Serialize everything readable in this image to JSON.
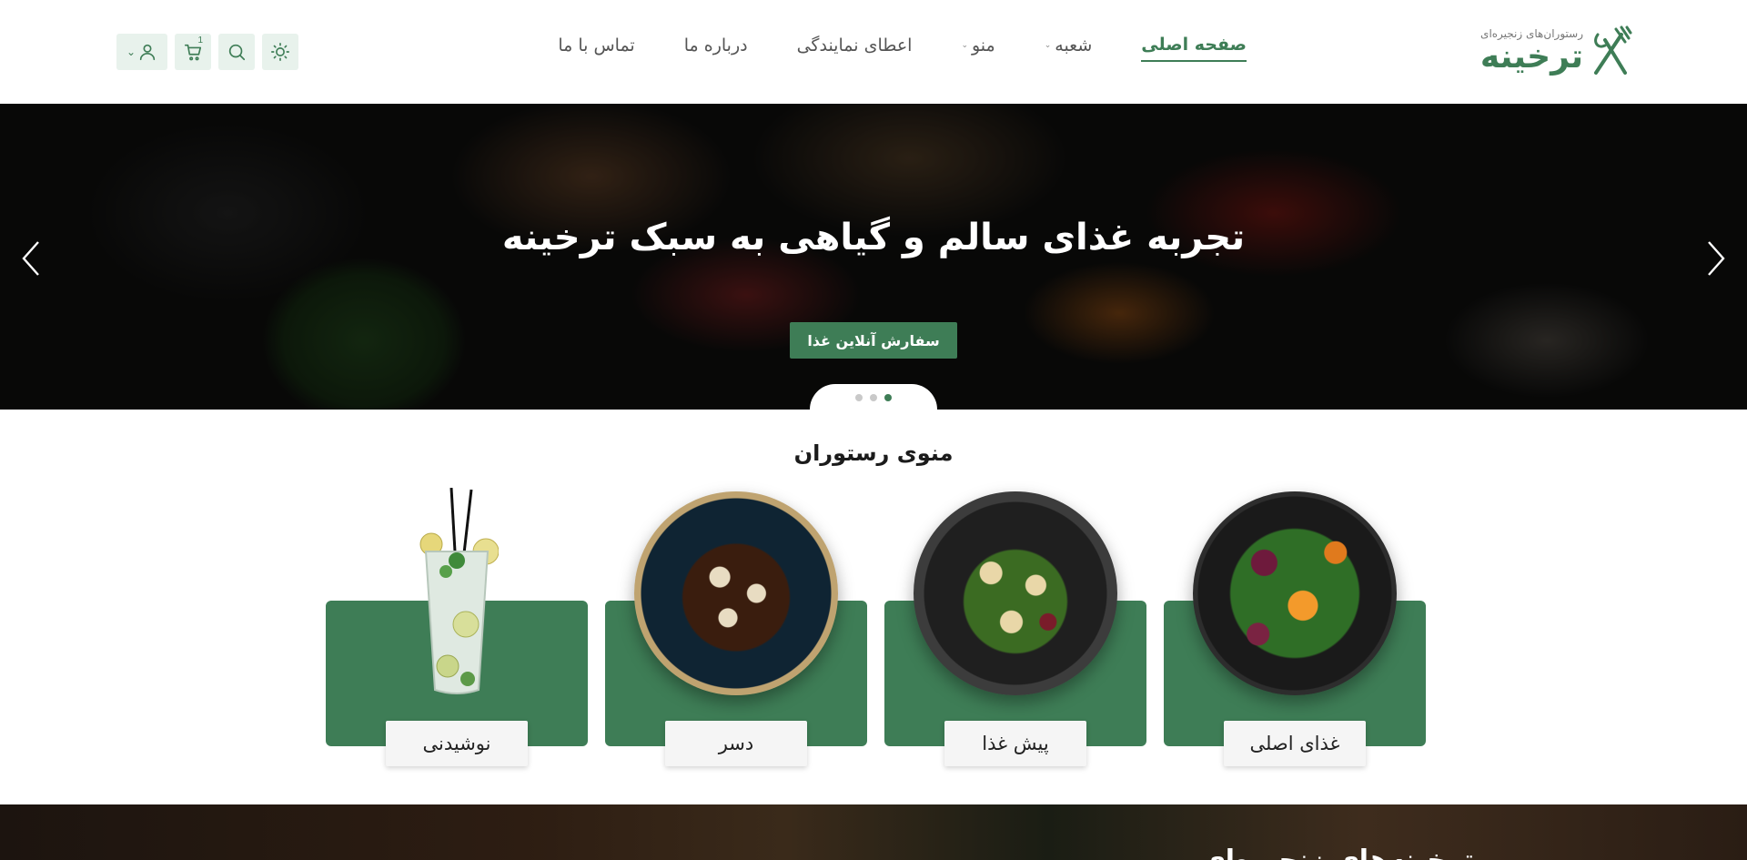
{
  "brand": {
    "name": "ترخینه",
    "subtitle": "رستوران‌های زنجیره‌ای"
  },
  "nav": {
    "items": [
      {
        "label": "صفحه اصلی",
        "active": true,
        "has_dropdown": false
      },
      {
        "label": "شعبه",
        "active": false,
        "has_dropdown": true
      },
      {
        "label": "منو",
        "active": false,
        "has_dropdown": true
      },
      {
        "label": "اعطای نمایندگی",
        "active": false,
        "has_dropdown": false
      },
      {
        "label": "درباره ما",
        "active": false,
        "has_dropdown": false
      },
      {
        "label": "تماس با ما",
        "active": false,
        "has_dropdown": false
      }
    ]
  },
  "toolbar": {
    "theme_icon": "sun-icon",
    "search_icon": "search-icon",
    "cart_icon": "cart-icon",
    "cart_count": "1",
    "user_icon": "user-icon"
  },
  "hero": {
    "title": "تجربه غذای سالم و گیاهی به سبک ترخینه",
    "button_label": "سفارش آنلاین غذا",
    "slides_total": 3,
    "active_slide": 1
  },
  "menu": {
    "title": "منوی رستوران",
    "categories": [
      {
        "label": "غذای اصلی",
        "image": "salad-plate"
      },
      {
        "label": "پیش غذا",
        "image": "starter-plate"
      },
      {
        "label": "دسر",
        "image": "dessert-plate"
      },
      {
        "label": "نوشیدنی",
        "image": "mojito-glass"
      }
    ]
  },
  "bottom": {
    "title": "ترخینه‌های زنجیره‌ای"
  },
  "colors": {
    "accent": "#3e7d56",
    "accent_soft": "#e8f2ec"
  }
}
